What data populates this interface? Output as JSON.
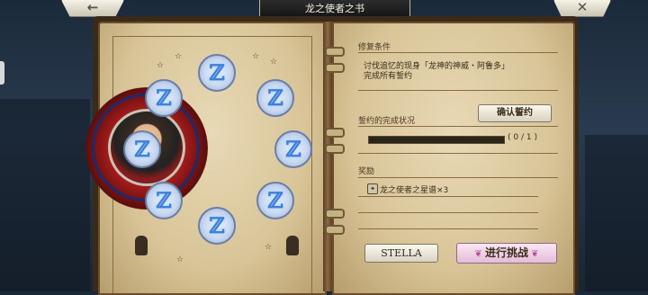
{
  "header": {
    "title": "龙之使者之书",
    "back_icon": "←",
    "close_icon": "✕"
  },
  "left_page": {
    "runes": [
      "ℤ",
      "ℤ",
      "ℤ",
      "ℤ",
      "ℤ",
      "ℤ",
      "ℤ",
      "ℤ"
    ]
  },
  "right_page": {
    "conditions": {
      "header": "修复条件",
      "line1": "讨伐追忆的现身「龙神的神威・阿鲁多」",
      "line2": "完成所有誓约"
    },
    "progress": {
      "header": "誓约的完成状况",
      "confirm_label": "确认誓约",
      "current": 0,
      "total": 1,
      "text": "( 0 / 1 )"
    },
    "reward": {
      "header": "奖励",
      "item": "龙之使者之星谱×3"
    },
    "stella_label": "STELLA",
    "challenge_label": "进行挑战"
  },
  "colors": {
    "accent_pink": "#e5bcd8",
    "parchment": "#e8d9b6"
  }
}
